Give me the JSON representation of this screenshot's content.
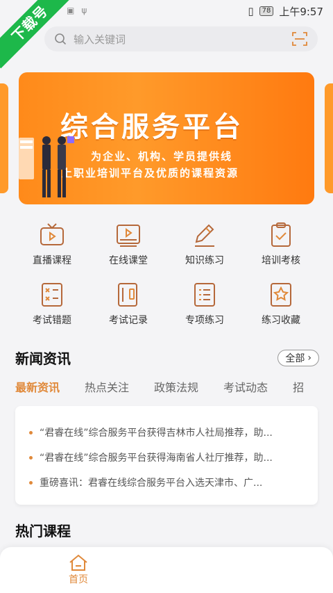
{
  "badge": {
    "label": "下载号"
  },
  "status_bar": {
    "battery": "78",
    "time": "上午9:57"
  },
  "search": {
    "placeholder": "输入关键词",
    "icon": "search-icon",
    "scan_icon": "scan-icon"
  },
  "banner": {
    "title": "综合服务平台",
    "subtitle_line1": "为企业、机构、学员提供线",
    "subtitle_line2": "上职业培训平台及优质的课程资源"
  },
  "grid": {
    "items": [
      {
        "label": "直播课程",
        "icon": "tv-icon"
      },
      {
        "label": "在线课堂",
        "icon": "video-player-icon"
      },
      {
        "label": "知识练习",
        "icon": "pencil-icon"
      },
      {
        "label": "培训考核",
        "icon": "clipboard-check-icon"
      },
      {
        "label": "考试错题",
        "icon": "error-sheet-icon"
      },
      {
        "label": "考试记录",
        "icon": "record-icon"
      },
      {
        "label": "专项练习",
        "icon": "list-icon"
      },
      {
        "label": "练习收藏",
        "icon": "star-bookmark-icon"
      }
    ]
  },
  "news": {
    "title": "新闻资讯",
    "all_label": "全部",
    "tabs": [
      "最新资讯",
      "热点关注",
      "政策法规",
      "考试动态",
      "招"
    ],
    "items": [
      "“君睿在线”综合服务平台获得吉林市人社局推荐，助...",
      "“君睿在线”综合服务平台获得海南省人社厅推荐，助...",
      "重磅喜讯：君睿在线综合服务平台入选天津市、广..."
    ]
  },
  "hot_courses": {
    "title": "热门课程"
  },
  "bottom_nav": {
    "home_label": "首页"
  },
  "colors": {
    "accent": "#e0893a",
    "banner": "#ff8a1a",
    "badge": "#1db84a"
  }
}
